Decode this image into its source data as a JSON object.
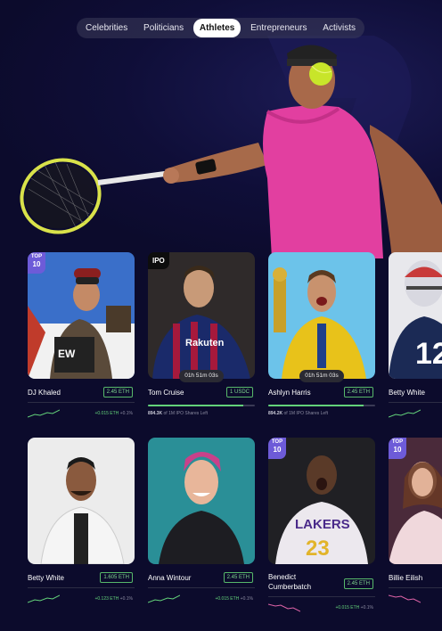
{
  "tabs": [
    "Celebrities",
    "Politicians",
    "Athletes",
    "Entrepreneurs",
    "Activists"
  ],
  "active_tab": "Athletes",
  "cards": [
    {
      "name": "DJ Khaled",
      "price": "2.45 ETH",
      "badge": "top",
      "badge_top": "TOP",
      "badge_num": "10",
      "change": "+0.015 ETH",
      "change_pct": "+0.1%",
      "trend": "up"
    },
    {
      "name": "Tom Cruise",
      "price": "1 USDC",
      "badge": "ipo",
      "badge_label": "IPO",
      "timer": "01h 51m 03s",
      "shares_value": "894.3K",
      "shares_text": "of 1M IPO Shares Left",
      "progress": 0.89
    },
    {
      "name": "Ashlyn Harris",
      "price": "2.45 ETH",
      "timer": "01h 51m 03s",
      "shares_value": "894.2K",
      "shares_text": "of 1M IPO Shares Left",
      "progress": 0.89
    },
    {
      "name": "Betty White",
      "trend": "up"
    },
    {
      "name": "Betty White",
      "price": "1.605 ETH",
      "change": "+0.123 ETH",
      "change_pct": "+0.1%",
      "trend": "up"
    },
    {
      "name": "Anna Wintour",
      "price": "2.45 ETH",
      "change": "+0.015 ETH",
      "change_pct": "+0.1%",
      "trend": "up"
    },
    {
      "name": "Benedict Cumberbatch",
      "price": "2.45 ETH",
      "badge": "top",
      "badge_top": "TOP",
      "badge_num": "10",
      "change": "+0.015 ETH",
      "change_pct": "+0.1%",
      "trend": "down"
    },
    {
      "name": "Billie Eilish",
      "badge": "top",
      "badge_top": "TOP",
      "badge_num": "10",
      "trend": "down"
    }
  ],
  "colors": {
    "accent": "#6d5bd8",
    "positive": "#63d27a",
    "negative": "#e064a8",
    "bg": "#0c0b2c"
  }
}
